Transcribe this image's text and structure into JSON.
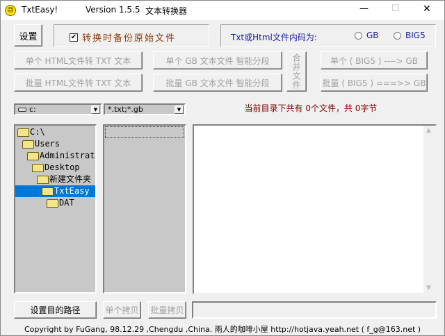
{
  "window": {
    "app_name": "TxtEasy!",
    "version": "Version 1.5.5",
    "subtitle": "文本转换器",
    "minimize": "—",
    "maximize": "☐",
    "close": "✕"
  },
  "toolbar": {
    "settings_label": "设置",
    "backup_label": "转换时备份原始文件",
    "backup_checked": true,
    "encoding_label": "Txt或Html文件内码为:",
    "encoding_options": [
      "GB",
      "BIG5"
    ]
  },
  "actions": {
    "single_html": "单个 HTML文件转 TXT 文本",
    "batch_html": "批量 HTML文件转 TXT 文本",
    "single_gb": "单个 GB 文本文件 智能分段",
    "batch_gb": "批量 GB 文本文件 智能分段",
    "merge": "合并文件",
    "single_big5": "单个 ( BIG5 ) ----> GB",
    "batch_big5": "批量 ( BIG5 ) ===>> GB"
  },
  "drive": "c:",
  "filter": "*.txt;*.gb",
  "status": "当前目录下共有 0个文件，共 0字节",
  "tree": [
    "C:\\",
    "Users",
    "Administrator",
    "Desktop",
    "新建文件夹",
    "TxtEasy",
    "DAT"
  ],
  "selected_folder": "TxtEasy",
  "bottom": {
    "set_dest": "设置目的路径",
    "single_copy": "单个拷贝",
    "batch_copy": "批量拷贝",
    "dest_path": ""
  },
  "footer": "Copyright by FuGang, 98.12.29 ,Chengdu ,China. 雨人的咖啡小屋 http://hotjava.yeah.net ( f_g@163.net )"
}
